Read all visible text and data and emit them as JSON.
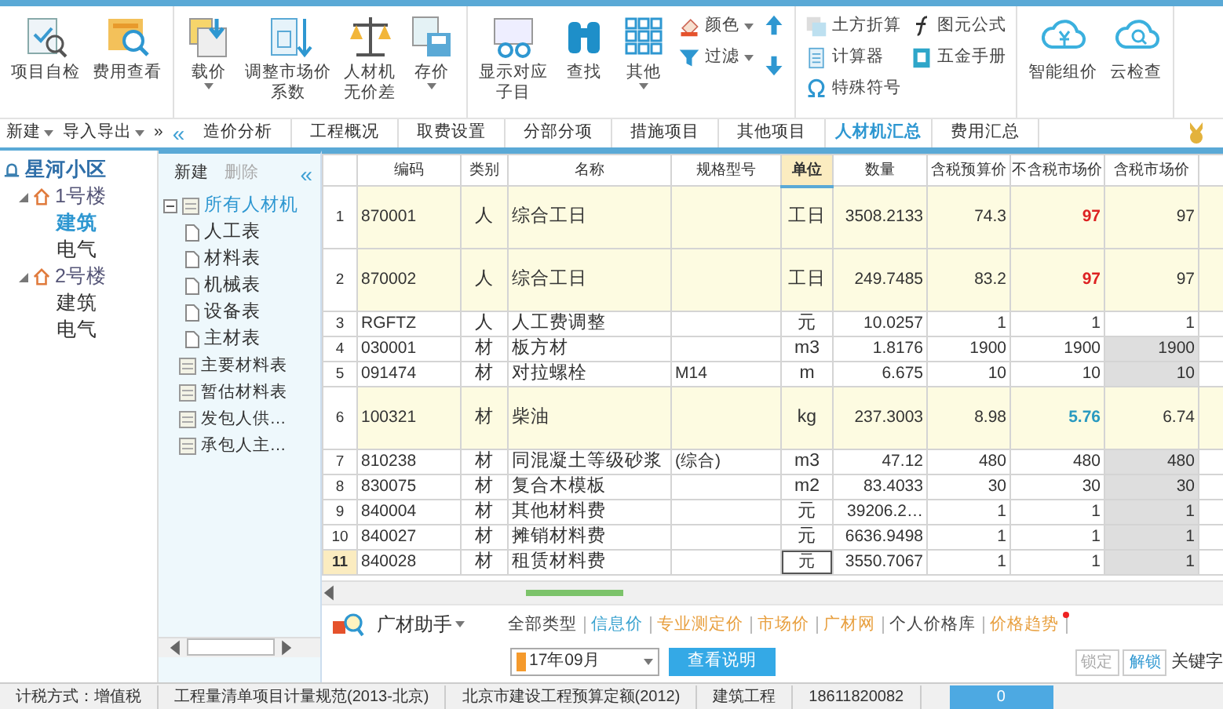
{
  "ribbon": {
    "groups": [
      {
        "items": [
          {
            "kind": "large",
            "lines": [
              "项目自检"
            ],
            "dropdown": false
          },
          {
            "kind": "large",
            "lines": [
              "费用查看"
            ],
            "dropdown": false
          }
        ]
      },
      {
        "items": [
          {
            "kind": "large",
            "lines": [
              "载价"
            ],
            "dropdown": true
          },
          {
            "kind": "large",
            "lines": [
              "调整市场价",
              "系数"
            ],
            "dropdown": false
          },
          {
            "kind": "large",
            "lines": [
              "人材机",
              "无价差"
            ],
            "dropdown": false
          },
          {
            "kind": "large",
            "lines": [
              "存价"
            ],
            "dropdown": true
          }
        ]
      },
      {
        "items": [
          {
            "kind": "large",
            "lines": [
              "显示对应",
              "子目"
            ],
            "dropdown": false
          },
          {
            "kind": "large",
            "lines": [
              "查找"
            ],
            "dropdown": false
          },
          {
            "kind": "large",
            "lines": [
              "其他"
            ],
            "dropdown": true
          },
          {
            "kind": "stack",
            "entries": [
              {
                "label": "颜色",
                "dropdown": true
              },
              {
                "label": "过滤",
                "dropdown": true
              }
            ]
          },
          {
            "kind": "arrows"
          }
        ]
      },
      {
        "items": [
          {
            "kind": "stack",
            "entries": [
              {
                "label": "土方折算",
                "dropdown": false
              },
              {
                "label": "计算器",
                "dropdown": false
              },
              {
                "label": "特殊符号",
                "dropdown": false
              }
            ]
          },
          {
            "kind": "stack",
            "entries": [
              {
                "label": "图元公式",
                "dropdown": false
              },
              {
                "label": "五金手册",
                "dropdown": false
              }
            ]
          }
        ]
      },
      {
        "items": [
          {
            "kind": "large",
            "lines": [
              "智能组价"
            ],
            "dropdown": false
          },
          {
            "kind": "large",
            "lines": [
              "云检查"
            ],
            "dropdown": false
          }
        ]
      }
    ]
  },
  "left_toolbar": {
    "buttons": [
      {
        "label": "新建",
        "dropdown": true
      },
      {
        "label": "导入导出",
        "dropdown": true
      }
    ],
    "more": "»",
    "collapse": "«"
  },
  "tabs": [
    {
      "label": "造价分析",
      "selected": false
    },
    {
      "label": "工程概况",
      "selected": false
    },
    {
      "label": "取费设置",
      "selected": false
    },
    {
      "label": "分部分项",
      "selected": false
    },
    {
      "label": "措施项目",
      "selected": false
    },
    {
      "label": "其他项目",
      "selected": false
    },
    {
      "label": "人材机汇总",
      "selected": true
    },
    {
      "label": "费用汇总",
      "selected": false
    }
  ],
  "project_tree": [
    {
      "label": "星河小区",
      "kind": "root",
      "selected": false,
      "children": [
        {
          "label": "1号楼",
          "kind": "building",
          "selected": false,
          "expanded": true,
          "children": [
            {
              "label": "建筑",
              "kind": "unit",
              "selected": true
            },
            {
              "label": "电气",
              "kind": "unit",
              "selected": false
            }
          ]
        },
        {
          "label": "2号楼",
          "kind": "building",
          "selected": false,
          "expanded": true,
          "children": [
            {
              "label": "建筑",
              "kind": "unit",
              "selected": false
            },
            {
              "label": "电气",
              "kind": "unit",
              "selected": false
            }
          ]
        }
      ]
    }
  ],
  "material_panel": {
    "buttons": [
      {
        "label": "新建",
        "disabled": false
      },
      {
        "label": "删除",
        "disabled": true
      }
    ],
    "collapse": "«",
    "tree": [
      {
        "label": "所有人材机",
        "kind": "folder",
        "selected": true,
        "expanded": true,
        "children": [
          {
            "label": "人工表",
            "kind": "page",
            "selected": false
          },
          {
            "label": "材料表",
            "kind": "page",
            "selected": false
          },
          {
            "label": "机械表",
            "kind": "page",
            "selected": false
          },
          {
            "label": "设备表",
            "kind": "page",
            "selected": false
          },
          {
            "label": "主材表",
            "kind": "page",
            "selected": false
          }
        ]
      },
      {
        "label": "主要材料表",
        "kind": "report",
        "selected": false
      },
      {
        "label": "暂估材料表",
        "kind": "report",
        "selected": false
      },
      {
        "label": "发包人供…",
        "kind": "report",
        "selected": false
      },
      {
        "label": "承包人主…",
        "kind": "report",
        "selected": false
      }
    ]
  },
  "table": {
    "columns": [
      {
        "label": "编码",
        "selected": false
      },
      {
        "label": "类别",
        "selected": false
      },
      {
        "label": "名称",
        "selected": false
      },
      {
        "label": "规格型号",
        "selected": false
      },
      {
        "label": "单位",
        "selected": true
      },
      {
        "label": "数量",
        "selected": false
      },
      {
        "label": "含税预算价",
        "selected": false
      },
      {
        "label": "不含税市场价",
        "selected": false
      },
      {
        "label": "含税市场价",
        "selected": false
      }
    ],
    "rows": [
      {
        "number": "1",
        "code": "870001",
        "type": "人",
        "name": "综合工日",
        "spec": "",
        "unit": "工日",
        "qty": "3508.2133",
        "budget_price": "74.3",
        "market_price_excl": "97",
        "market_price_incl": "97",
        "highlighted": true,
        "price_changed": true,
        "price_adjusted": false,
        "locked": false,
        "selected": false
      },
      {
        "number": "2",
        "code": "870002",
        "type": "人",
        "name": "综合工日",
        "spec": "",
        "unit": "工日",
        "qty": "249.7485",
        "budget_price": "83.2",
        "market_price_excl": "97",
        "market_price_incl": "97",
        "highlighted": true,
        "price_changed": true,
        "price_adjusted": false,
        "locked": false,
        "selected": false
      },
      {
        "number": "3",
        "code": "RGFTZ",
        "type": "人",
        "name": "人工费调整",
        "spec": "",
        "unit": "元",
        "qty": "10.0257",
        "budget_price": "1",
        "market_price_excl": "1",
        "market_price_incl": "1",
        "highlighted": false,
        "price_changed": false,
        "price_adjusted": false,
        "locked": false,
        "selected": false
      },
      {
        "number": "4",
        "code": "030001",
        "type": "材",
        "name": "板方材",
        "spec": "",
        "unit": "m3",
        "qty": "1.8176",
        "budget_price": "1900",
        "market_price_excl": "1900",
        "market_price_incl": "1900",
        "highlighted": false,
        "price_changed": false,
        "price_adjusted": false,
        "locked": true,
        "selected": false
      },
      {
        "number": "5",
        "code": "091474",
        "type": "材",
        "name": "对拉螺栓",
        "spec": "M14",
        "unit": "m",
        "qty": "6.675",
        "budget_price": "10",
        "market_price_excl": "10",
        "market_price_incl": "10",
        "highlighted": false,
        "price_changed": false,
        "price_adjusted": false,
        "locked": true,
        "selected": false
      },
      {
        "number": "6",
        "code": "100321",
        "type": "材",
        "name": "柴油",
        "spec": "",
        "unit": "kg",
        "qty": "237.3003",
        "budget_price": "8.98",
        "market_price_excl": "5.76",
        "market_price_incl": "6.74",
        "highlighted": true,
        "price_changed": false,
        "price_adjusted": true,
        "locked": false,
        "selected": false
      },
      {
        "number": "7",
        "code": "810238",
        "type": "材",
        "name": "同混凝土等级砂浆",
        "spec": "(综合)",
        "unit": "m3",
        "qty": "47.12",
        "budget_price": "480",
        "market_price_excl": "480",
        "market_price_incl": "480",
        "highlighted": false,
        "price_changed": false,
        "price_adjusted": false,
        "locked": true,
        "selected": false
      },
      {
        "number": "8",
        "code": "830075",
        "type": "材",
        "name": "复合木模板",
        "spec": "",
        "unit": "m2",
        "qty": "83.4033",
        "budget_price": "30",
        "market_price_excl": "30",
        "market_price_incl": "30",
        "highlighted": false,
        "price_changed": false,
        "price_adjusted": false,
        "locked": true,
        "selected": false
      },
      {
        "number": "9",
        "code": "840004",
        "type": "材",
        "name": "其他材料费",
        "spec": "",
        "unit": "元",
        "qty": "39206.2…",
        "budget_price": "1",
        "market_price_excl": "1",
        "market_price_incl": "1",
        "highlighted": false,
        "price_changed": false,
        "price_adjusted": false,
        "locked": true,
        "selected": false
      },
      {
        "number": "10",
        "code": "840027",
        "type": "材",
        "name": "摊销材料费",
        "spec": "",
        "unit": "元",
        "qty": "6636.9498",
        "budget_price": "1",
        "market_price_excl": "1",
        "market_price_incl": "1",
        "highlighted": false,
        "price_changed": false,
        "price_adjusted": false,
        "locked": true,
        "selected": false
      },
      {
        "number": "11",
        "code": "840028",
        "type": "材",
        "name": "租赁材料费",
        "spec": "",
        "unit": "元",
        "qty": "3550.7067",
        "budget_price": "1",
        "market_price_excl": "1",
        "market_price_incl": "1",
        "highlighted": false,
        "price_changed": false,
        "price_adjusted": false,
        "locked": true,
        "selected": true
      }
    ]
  },
  "price_helper": {
    "title": "广材助手",
    "dropdown": true,
    "filters": [
      {
        "label": "全部类型",
        "color": "#444444",
        "notice": false
      },
      {
        "label": "信息价",
        "color": "#3ba3d0",
        "notice": false
      },
      {
        "label": "专业测定价",
        "color": "#e8a040",
        "notice": false
      },
      {
        "label": "市场价",
        "color": "#e8a040",
        "notice": false
      },
      {
        "label": "广材网",
        "color": "#e8a040",
        "notice": false
      },
      {
        "label": "个人价格库",
        "color": "#444444",
        "notice": false
      },
      {
        "label": "价格趋势",
        "color": "#e8a040",
        "notice": true
      }
    ],
    "period": "17年09月",
    "info_button": "查看说明",
    "lock_buttons": [
      {
        "label": "锁定",
        "disabled": true
      },
      {
        "label": "解锁",
        "disabled": false
      }
    ],
    "keyword_label": "关键字"
  },
  "status_bar": {
    "items": [
      "计税方式：增值税",
      "工程量清单项目计量规范(2013-北京)",
      "北京市建设工程预算定额(2012)",
      "建筑工程",
      "18611820082"
    ],
    "counter": "0"
  }
}
